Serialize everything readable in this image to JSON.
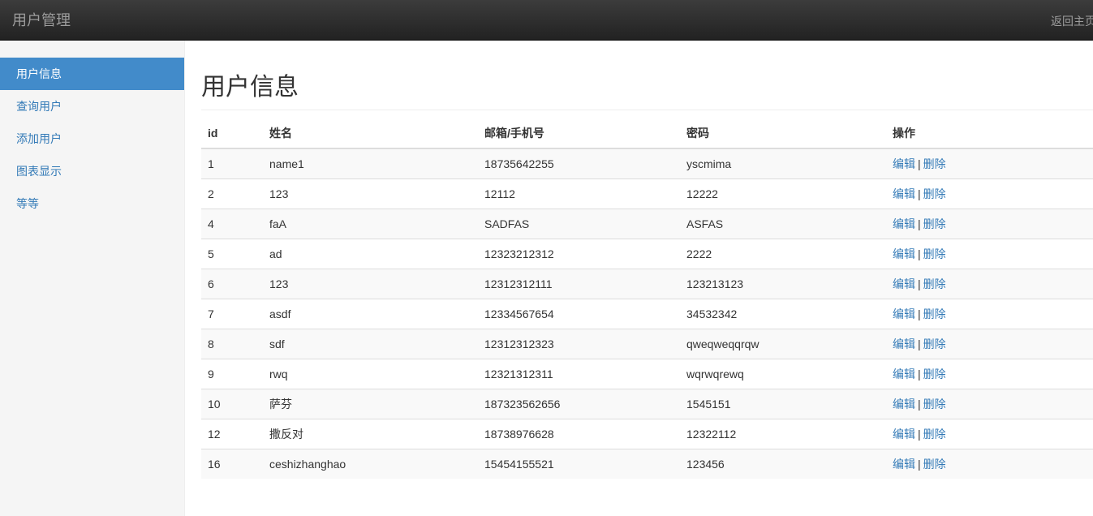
{
  "navbar": {
    "brand": "用户管理",
    "back_home": "返回主页"
  },
  "sidebar": {
    "items": [
      {
        "label": "用户信息",
        "active": true
      },
      {
        "label": "查询用户",
        "active": false
      },
      {
        "label": "添加用户",
        "active": false
      },
      {
        "label": "图表显示",
        "active": false
      },
      {
        "label": "等等",
        "active": false
      }
    ]
  },
  "main": {
    "title": "用户信息",
    "table": {
      "headers": {
        "id": "id",
        "name": "姓名",
        "email": "邮箱/手机号",
        "password": "密码",
        "actions": "操作"
      },
      "edit_label": "编辑",
      "separator": "|",
      "delete_label": "删除",
      "rows": [
        {
          "id": "1",
          "name": "name1",
          "email": "18735642255",
          "password": "yscmima"
        },
        {
          "id": "2",
          "name": "123",
          "email": "12112",
          "password": "12222"
        },
        {
          "id": "4",
          "name": "faA",
          "email": "SADFAS",
          "password": "ASFAS"
        },
        {
          "id": "5",
          "name": "ad",
          "email": "12323212312",
          "password": "2222"
        },
        {
          "id": "6",
          "name": "123",
          "email": "12312312111",
          "password": "123213123"
        },
        {
          "id": "7",
          "name": "asdf",
          "email": "12334567654",
          "password": "34532342"
        },
        {
          "id": "8",
          "name": "sdf",
          "email": "12312312323",
          "password": "qweqweqqrqw"
        },
        {
          "id": "9",
          "name": "rwq",
          "email": "12321312311",
          "password": "wqrwqrewq"
        },
        {
          "id": "10",
          "name": "萨芬",
          "email": "187323562656",
          "password": "1545151"
        },
        {
          "id": "12",
          "name": "撒反对",
          "email": "18738976628",
          "password": "12322112"
        },
        {
          "id": "16",
          "name": "ceshizhanghao",
          "email": "15454155521",
          "password": "123456"
        }
      ]
    }
  }
}
